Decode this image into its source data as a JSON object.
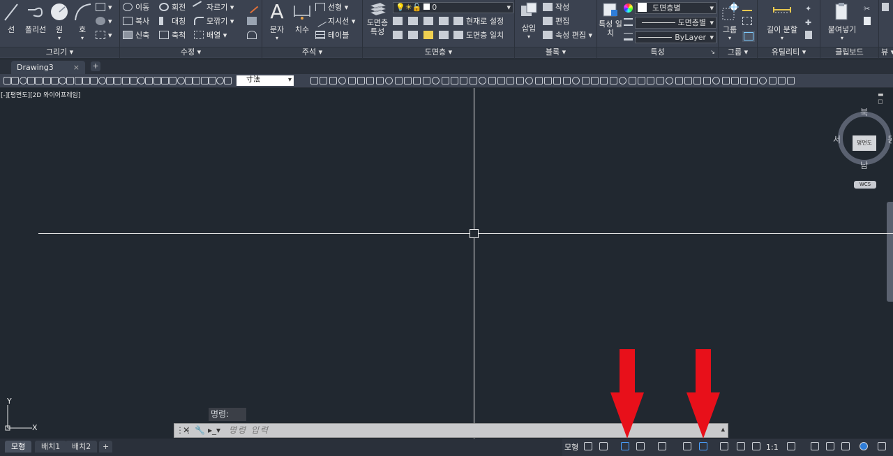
{
  "ribbon": {
    "draw": {
      "title": "그리기",
      "line": "선",
      "polyline": "폴리선",
      "circle": "원",
      "arc": "호"
    },
    "modify": {
      "title": "수정",
      "items": [
        "이동",
        "회전",
        "자르기",
        "복사",
        "대칭",
        "모깎기",
        "신축",
        "축척",
        "배열"
      ]
    },
    "annotation": {
      "title": "주석",
      "text": "문자",
      "dimension": "치수",
      "items": [
        "선형",
        "지시선",
        "테이블"
      ]
    },
    "layers": {
      "title": "도면층",
      "layer_props": "도면층 특성",
      "layer_name": "0",
      "set_current": "현재로 설정",
      "match_layer": "도면층 일치"
    },
    "block": {
      "title": "블록",
      "insert": "삽입",
      "create": "작성",
      "edit": "편집",
      "edit_attributes": "속성 편집"
    },
    "properties": {
      "title": "특성",
      "match": "특성 일치",
      "color": "도면층별",
      "linetype": "도면층별",
      "lineweight": "ByLayer"
    },
    "groups": {
      "title": "그룹",
      "group": "그룹"
    },
    "utilities": {
      "title": "유틸리티",
      "measure": "길이 분할"
    },
    "clipboard": {
      "title": "클립보드",
      "paste": "붙여넣기"
    },
    "view": {
      "title": "뷰"
    }
  },
  "tabs": {
    "drawing": "Drawing3",
    "close": "×",
    "add": "+"
  },
  "toolbar": {
    "dimstyle": "寸法"
  },
  "viewport": {
    "label": "[-][평면도][2D 와이어프레임]",
    "viewcube": {
      "north": "북",
      "south": "남",
      "west": "서",
      "east": "동",
      "face": "평면도",
      "wcs": "WCS"
    }
  },
  "command": {
    "history": "명령:",
    "placeholder": "명령 입력"
  },
  "layout_tabs": [
    "모형",
    "배치1",
    "배치2"
  ],
  "status": {
    "model": "모형",
    "scale": "1:1"
  },
  "colors": {
    "canvas": "#212830",
    "ribbon": "#3b4250",
    "arrow": "#e8101a",
    "accent": "#2f7dd8"
  }
}
